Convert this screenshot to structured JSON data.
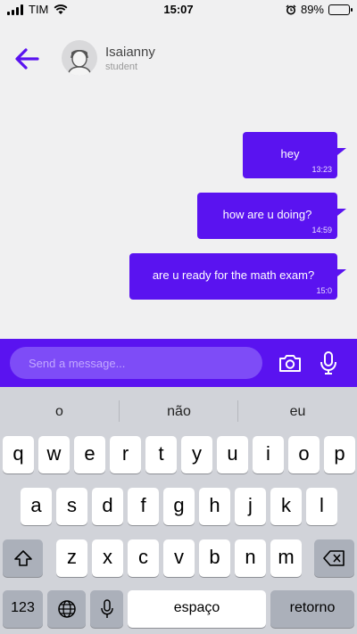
{
  "status_bar": {
    "carrier": "TIM",
    "time": "15:07",
    "battery": "89%",
    "battery_level": 0.89
  },
  "header": {
    "contact_name": "Isaianny",
    "contact_role": "student"
  },
  "messages": [
    {
      "text": "hey",
      "time": "13:23"
    },
    {
      "text": "how are u doing?",
      "time": "14:59"
    },
    {
      "text": "are u ready for the math exam?",
      "time": "15:0"
    }
  ],
  "composer": {
    "placeholder": "Send a message..."
  },
  "keyboard": {
    "suggestions": [
      "o",
      "não",
      "eu"
    ],
    "row1": [
      "q",
      "w",
      "e",
      "r",
      "t",
      "y",
      "u",
      "i",
      "o",
      "p"
    ],
    "row2": [
      "a",
      "s",
      "d",
      "f",
      "g",
      "h",
      "j",
      "k",
      "l"
    ],
    "row3": [
      "z",
      "x",
      "c",
      "v",
      "b",
      "n",
      "m"
    ],
    "numbers_label": "123",
    "space_label": "espaço",
    "return_label": "retorno"
  },
  "colors": {
    "accent": "#5a13f0",
    "input_bg": "#7e4cf7",
    "background": "#f0f0f1",
    "keyboard_bg": "#d1d3d9"
  },
  "icons": [
    "signal-icon",
    "wifi-icon",
    "alarm-icon",
    "battery-icon",
    "back-arrow-icon",
    "avatar-placeholder",
    "camera-icon",
    "microphone-icon",
    "shift-icon",
    "backspace-icon",
    "globe-icon",
    "dictation-icon"
  ]
}
